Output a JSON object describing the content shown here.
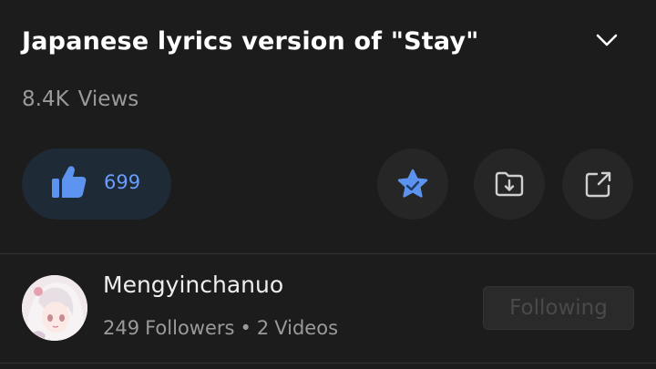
{
  "video": {
    "title": "Japanese lyrics version of \"Stay\"",
    "views_count": "8.4K",
    "views_label": "Views"
  },
  "actions": {
    "like_count": "699",
    "like_icon": "thumbs-up-icon",
    "favorite_icon": "star-icon",
    "download_icon": "folder-download-icon",
    "share_icon": "share-icon",
    "accent_color": "#6a9dff"
  },
  "uploader": {
    "name": "Mengyinchanuo",
    "followers_count": "249",
    "followers_label": "Followers",
    "separator": "•",
    "videos_count": "2",
    "videos_label": "Videos",
    "follow_label": "Following"
  }
}
